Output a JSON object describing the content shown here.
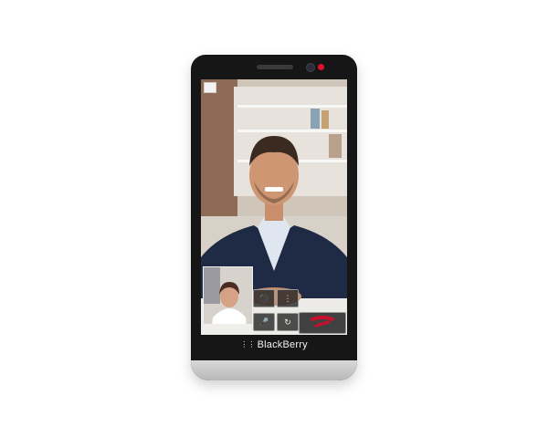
{
  "device": {
    "brand": "BlackBerry"
  },
  "video_call": {
    "controls": {
      "camera_icon": "camera-icon",
      "bbm_icon": "bbm-icon",
      "mute_icon": "microphone-icon",
      "switch_icon": "switch-camera-icon",
      "end_call_icon": "end-call-icon"
    }
  },
  "colors": {
    "led": "#e0102a",
    "end_call": "#c8102e"
  }
}
